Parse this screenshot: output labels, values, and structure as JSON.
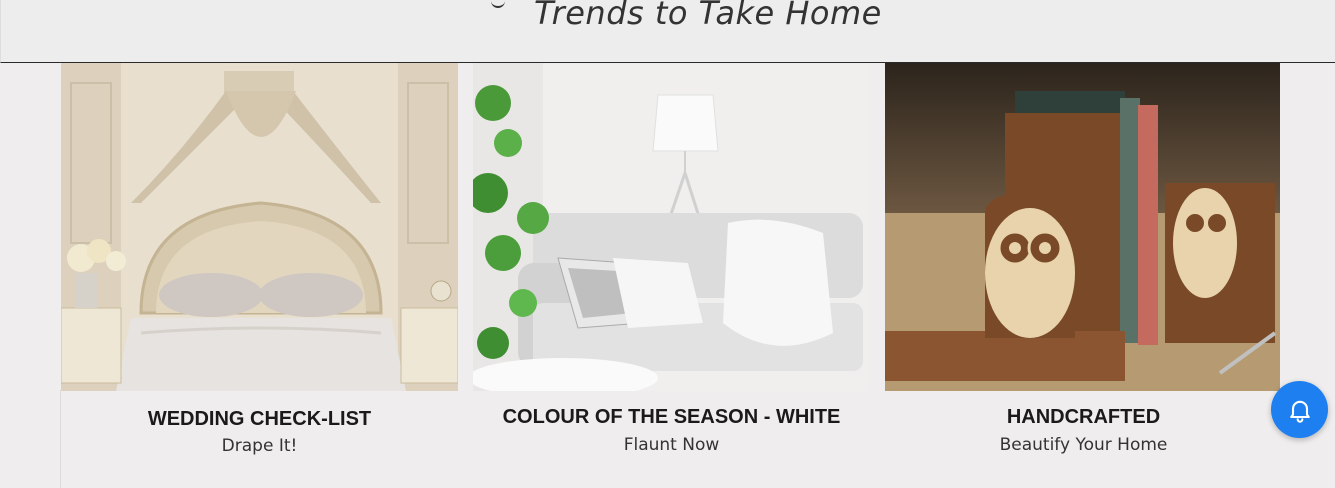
{
  "header": {
    "title": "Trends to Take Home"
  },
  "cards": [
    {
      "title": "WEDDING CHECK-LIST",
      "subtitle": "Drape It!"
    },
    {
      "title": "COLOUR OF THE SEASON - WHITE",
      "subtitle": "Flaunt Now"
    },
    {
      "title": "HANDCRAFTED",
      "subtitle": "Beautify Your Home"
    }
  ],
  "notification": {
    "icon": "bell-icon",
    "color": "#1e7ff0"
  }
}
